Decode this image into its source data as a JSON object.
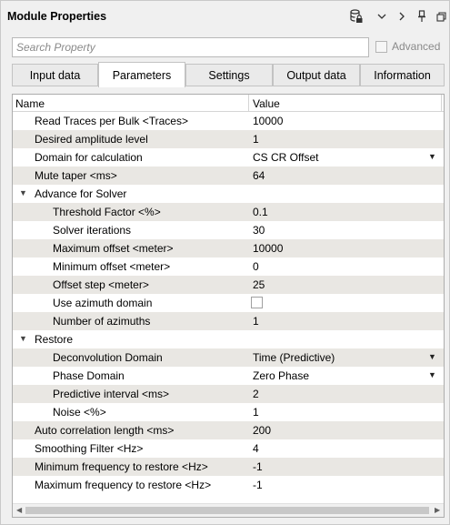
{
  "window": {
    "title": "Module Properties"
  },
  "toolbar": {
    "icons": [
      "database-lock-icon",
      "chevron-down-icon",
      "chevron-right-icon",
      "pin-icon",
      "restore-window-icon"
    ]
  },
  "search": {
    "placeholder": "Search Property",
    "value": ""
  },
  "advanced": {
    "label": "Advanced",
    "checked": false,
    "enabled": false
  },
  "tabs": [
    {
      "label": "Input data",
      "active": false
    },
    {
      "label": "Parameters",
      "active": true
    },
    {
      "label": "Settings",
      "active": false
    },
    {
      "label": "Output data",
      "active": false
    },
    {
      "label": "Information",
      "active": false
    }
  ],
  "grid": {
    "columns": {
      "name": "Name",
      "value": "Value"
    },
    "rows": [
      {
        "name": "Read Traces per Bulk <Traces>",
        "value": "10000",
        "level": 1,
        "kind": "text"
      },
      {
        "name": "Desired amplitude level",
        "value": "1",
        "level": 1,
        "kind": "text"
      },
      {
        "name": "Domain for calculation",
        "value": "CS CR Offset",
        "level": 1,
        "kind": "dropdown"
      },
      {
        "name": "Mute taper <ms>",
        "value": "64",
        "level": 1,
        "kind": "text"
      },
      {
        "name": "Advance for Solver",
        "value": "",
        "level": 0,
        "kind": "group"
      },
      {
        "name": "Threshold Factor <%>",
        "value": "0.1",
        "level": 2,
        "kind": "text"
      },
      {
        "name": "Solver iterations",
        "value": "30",
        "level": 2,
        "kind": "text"
      },
      {
        "name": "Maximum offset <meter>",
        "value": "10000",
        "level": 2,
        "kind": "text"
      },
      {
        "name": "Minimum offset <meter>",
        "value": "0",
        "level": 2,
        "kind": "text"
      },
      {
        "name": "Offset step <meter>",
        "value": "25",
        "level": 2,
        "kind": "text"
      },
      {
        "name": "Use azimuth domain",
        "value": "",
        "level": 2,
        "kind": "checkbox"
      },
      {
        "name": "Number of azimuths",
        "value": "1",
        "level": 2,
        "kind": "text"
      },
      {
        "name": "Restore",
        "value": "",
        "level": 0,
        "kind": "group"
      },
      {
        "name": "Deconvolution Domain",
        "value": "Time (Predictive)",
        "level": 2,
        "kind": "dropdown"
      },
      {
        "name": "Phase Domain",
        "value": "Zero Phase",
        "level": 2,
        "kind": "dropdown"
      },
      {
        "name": "Predictive interval <ms>",
        "value": "2",
        "level": 2,
        "kind": "text"
      },
      {
        "name": "Noise <%>",
        "value": "1",
        "level": 2,
        "kind": "text"
      },
      {
        "name": "Auto correlation length <ms>",
        "value": "200",
        "level": 1,
        "kind": "text"
      },
      {
        "name": "Smoothing Filter <Hz>",
        "value": "4",
        "level": 1,
        "kind": "text"
      },
      {
        "name": "Minimum frequency to restore <Hz>",
        "value": "-1",
        "level": 1,
        "kind": "text"
      },
      {
        "name": "Maximum frequency to restore <Hz>",
        "value": "-1",
        "level": 1,
        "kind": "text"
      }
    ]
  }
}
